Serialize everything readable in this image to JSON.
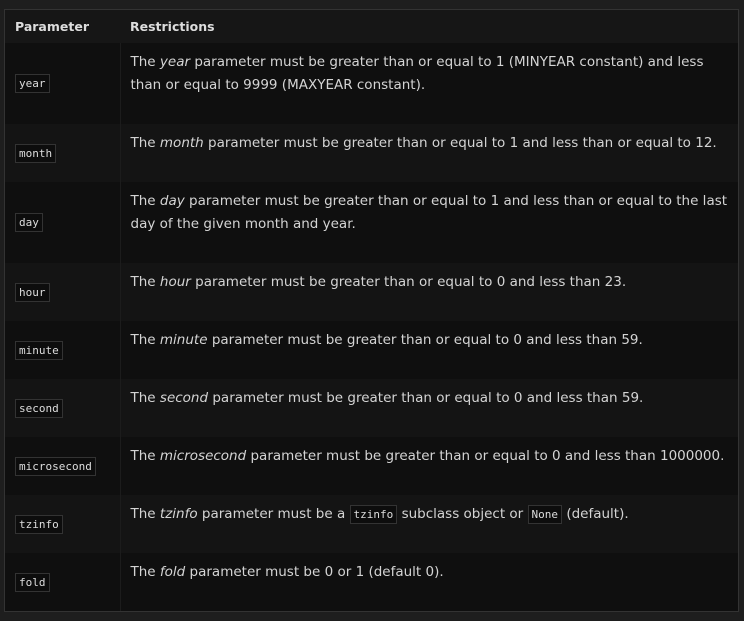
{
  "header": {
    "parameter": "Parameter",
    "restrictions": "Restrictions"
  },
  "rows": [
    {
      "param": "year",
      "segs": [
        {
          "t": "The "
        },
        {
          "em": "year"
        },
        {
          "t": " parameter must be greater than or equal to 1 (MINYEAR constant) and less than or equal to 9999 (MAXYEAR constant)."
        }
      ]
    },
    {
      "param": "month",
      "segs": [
        {
          "t": "The "
        },
        {
          "em": "month"
        },
        {
          "t": " parameter must be greater than or equal to 1 and less than or equal to 12."
        }
      ]
    },
    {
      "param": "day",
      "segs": [
        {
          "t": "The "
        },
        {
          "em": "day"
        },
        {
          "t": " parameter must be greater than or equal to 1 and less than or equal to the last day of the given month and year."
        }
      ]
    },
    {
      "param": "hour",
      "segs": [
        {
          "t": "The "
        },
        {
          "em": "hour"
        },
        {
          "t": " parameter must be greater than or equal to 0 and less than 23."
        }
      ]
    },
    {
      "param": "minute",
      "segs": [
        {
          "t": "The "
        },
        {
          "em": "minute"
        },
        {
          "t": " parameter must be greater than or equal to 0 and less than 59."
        }
      ]
    },
    {
      "param": "second",
      "segs": [
        {
          "t": "The "
        },
        {
          "em": "second"
        },
        {
          "t": " parameter must be greater than or equal to 0 and less than 59."
        }
      ]
    },
    {
      "param": "microsecond",
      "segs": [
        {
          "t": "The "
        },
        {
          "em": "microsecond"
        },
        {
          "t": " parameter must be greater than or equal to 0 and less than 1000000."
        }
      ]
    },
    {
      "param": "tzinfo",
      "segs": [
        {
          "t": "The "
        },
        {
          "em": "tzinfo"
        },
        {
          "t": " parameter must be a "
        },
        {
          "code": "tzinfo"
        },
        {
          "t": " subclass object or "
        },
        {
          "code": "None"
        },
        {
          "t": " (default)."
        }
      ]
    },
    {
      "param": "fold",
      "segs": [
        {
          "t": "The "
        },
        {
          "em": "fold"
        },
        {
          "t": " parameter must be 0 or 1 (default 0)."
        }
      ]
    }
  ]
}
